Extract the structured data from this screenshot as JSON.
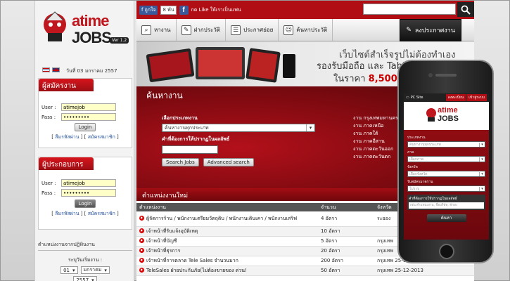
{
  "left": {
    "logo_main": "atime",
    "logo_sub": "JOBS",
    "logo_version": "Ver 1.2",
    "date": "วันที่ 03 มกราคม 2557",
    "applicant_panel": {
      "title": "ผู้สมัครงาน",
      "user_label": "User :",
      "user_value": "atimejob",
      "pass_label": "Pass :",
      "pass_value": "•••••••••",
      "login_label": "Login",
      "forgot": "ลืมรหัสผ่าน",
      "register": "สมัครสมาชิก"
    },
    "employer_panel": {
      "title": "ผู้ประกอบการ",
      "user_label": "User :",
      "user_value": "atimejob",
      "pass_label": "Pass :",
      "pass_value": "•••••••••",
      "login_label": "Login",
      "forgot": "ลืมรหัสผ่าน",
      "register": "สมัครสมาชิก"
    },
    "calendar": {
      "title": "ตำแหน่งงานจากปฏิทินงาน",
      "sub": "ระบุวันเริ่มงาน :",
      "day": "01",
      "month": "มกราคม",
      "year": "2557"
    }
  },
  "topbar": {
    "like_label": "ถูกใจ",
    "like_count": "8 พัน",
    "fb_text": "กด Like ให้เราเป็นแฟน"
  },
  "nav": {
    "items": [
      {
        "label": "หางาน",
        "icon": "search"
      },
      {
        "label": "ฝากประวัติ",
        "icon": "document"
      },
      {
        "label": "ประกาศย่อย",
        "icon": "list"
      },
      {
        "label": "ค้นหาประวัติ",
        "icon": "person"
      }
    ],
    "post_label": "ลงประกาศงาน"
  },
  "banner": {
    "line1": "เว็บไซต์สำเร็จรูปไม่ต้องทำเอง",
    "line2": "รองรับมือถือ และ Tablet ทุกรุ่น",
    "line3_prefix": "ในราคา",
    "line3_price": "8,500"
  },
  "search": {
    "title": "ค้นหางาน",
    "category_label": "เลือกประเภทงาน",
    "category_value": "ค้นหางานทุกประเภท",
    "keyword_label": "คำที่ต้องการให้ปรากฏในผลลัพธ์",
    "search_button": "Search Jobs",
    "advanced_button": "Advanced search",
    "areas": [
      "งาน กรุงเทพมหานคร",
      "งาน ภาคเหนือ",
      "งาน ภาคใต้",
      "งาน ภาคอีสาน",
      "งาน ภาคตะวันออก",
      "งาน ภาคตะวันตก"
    ]
  },
  "jobs": {
    "section_title": "ตำแหน่งงานใหม่",
    "headers": [
      "ตำแหน่งงาน",
      "จำนวน",
      "จังหวัด"
    ],
    "rows": [
      {
        "title": "ผู้จัดการร้าน / พนักงานเตรียมวัตถุดิบ / พนักงานเดินเคา / พนักงานเสริฟ",
        "count": "4 อัตรา",
        "province": "ระยอง",
        "date": ""
      },
      {
        "title": "เจ้าหน้าที่รับแจ้งอุบัติเหตุ",
        "count": "10 อัตรา",
        "province": "",
        "date": ""
      },
      {
        "title": "เจ้าหน้าที่บัญชี",
        "count": "5 อัตรา",
        "province": "กรุงเทพ",
        "date": ""
      },
      {
        "title": "เจ้าหน้าที่ธุรการ",
        "count": "20 อัตรา",
        "province": "กรุงเทพ",
        "date": ""
      },
      {
        "title": "เจ้าหน้าที่การตลาด Tele Sales จำนวนมาก",
        "count": "200 อัตรา",
        "province": "กรุงเทพ",
        "date": "25-12-2013"
      },
      {
        "title": "TeleSales ฝ่ายประกันภัย(ไม่ต้องขายของ ด่วน!",
        "count": "50 อัตรา",
        "province": "กรุงเทพ",
        "date": "25-12-2013"
      }
    ]
  },
  "phone": {
    "pc_site": "PC Site",
    "tab1": "ลงทะเบียน",
    "tab2": "เข้าสู่ระบบ",
    "logo_main": "atime",
    "logo_sub": "JOBS",
    "fields": [
      {
        "label": "ประเภทงาน",
        "value": "ค้นหางานทุกประเภท"
      },
      {
        "label": "ภาค",
        "value": "เลือกภาค"
      },
      {
        "label": "จังหวัด",
        "value": "เลือกจังหวัด"
      },
      {
        "label": "รับสมัครมาตราน",
        "value": "ไม่ระบุ"
      }
    ],
    "keyword_label": "คำที่ต้องการให้ปรากฏในผลลัพธ์",
    "keyword_placeholder": "เช่น ตำแหน่งงาน, ชื่อบริษัท, ทักษะ",
    "search_button": "ค้นหา"
  }
}
